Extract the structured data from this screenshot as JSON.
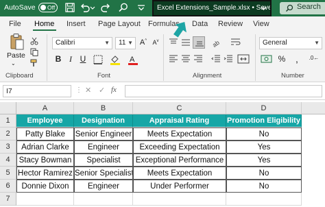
{
  "titlebar": {
    "autosave_label": "AutoSave",
    "autosave_state": "Off",
    "filename": "Excel Extensions_Sample.xlsx  •  Saved",
    "search_label": "Search"
  },
  "tabs": [
    "File",
    "Home",
    "Insert",
    "Page Layout",
    "Formulas",
    "Data",
    "Review",
    "View"
  ],
  "active_tab": "Home",
  "ribbon": {
    "clipboard_label": "Clipboard",
    "paste_label": "Paste",
    "font_label": "Font",
    "font_name": "Calibri",
    "font_size": "11",
    "alignment_label": "Alignment",
    "number_label": "Number",
    "number_format": "General"
  },
  "formula_bar": {
    "name_box": "I7",
    "fx": "fx",
    "formula": ""
  },
  "columns": [
    "A",
    "B",
    "C",
    "D"
  ],
  "rows": [
    "1",
    "2",
    "3",
    "4",
    "5",
    "6",
    "7"
  ],
  "table": {
    "headers": [
      "Employee",
      "Designation",
      "Appraisal Rating",
      "Promotion Eligibility"
    ],
    "rows": [
      [
        "Patty Blake",
        "Senior Engineer",
        "Meets Expectation",
        "No"
      ],
      [
        "Adrian Clarke",
        "Engineer",
        "Exceeding Expectation",
        "Yes"
      ],
      [
        "Stacy Bowman",
        "Specialist",
        "Exceptional Performance",
        "Yes"
      ],
      [
        "Hector Ramirez",
        "Senior Specialist",
        "Meets Expectation",
        "No"
      ],
      [
        "Donnie Dixon",
        "Engineer",
        "Under Performer",
        "No"
      ]
    ]
  },
  "colors": {
    "excel_green": "#217346",
    "header_teal": "#16a6a6"
  }
}
